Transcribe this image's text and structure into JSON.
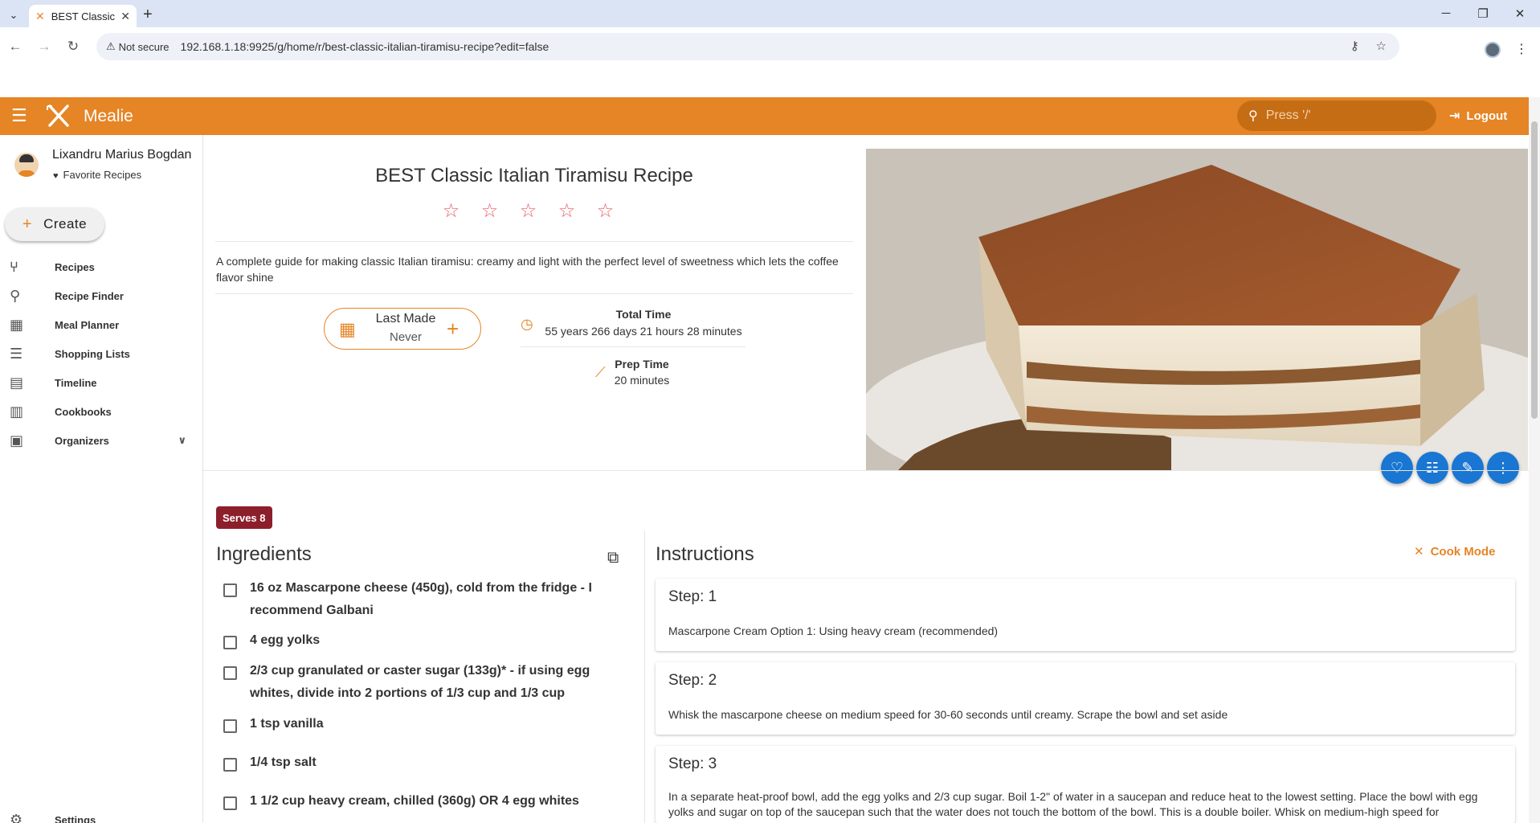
{
  "browser": {
    "tab_title": "BEST Classic",
    "not_secure": "Not secure",
    "url": "192.168.1.18:9925/g/home/r/best-classic-italian-tiramisu-recipe?edit=false"
  },
  "app": {
    "brand": "Mealie",
    "search_placeholder": "Press '/'",
    "logout": "Logout",
    "accent_color": "#e58525"
  },
  "sidebar": {
    "user_name": "Lixandru Marius Bogdan",
    "favorite": "Favorite Recipes",
    "create": "Create",
    "items": [
      {
        "label": "Recipes",
        "icon": "fork-knife-icon"
      },
      {
        "label": "Recipe Finder",
        "icon": "search-icon"
      },
      {
        "label": "Meal Planner",
        "icon": "calendar-icon"
      },
      {
        "label": "Shopping Lists",
        "icon": "checklist-icon"
      },
      {
        "label": "Timeline",
        "icon": "timeline-icon"
      },
      {
        "label": "Cookbooks",
        "icon": "book-icon"
      },
      {
        "label": "Organizers",
        "icon": "cabinet-icon"
      }
    ],
    "settings": "Settings"
  },
  "recipe": {
    "title": "BEST Classic Italian Tiramisu Recipe",
    "description": "A complete guide for making classic Italian tiramisu: creamy and light with the perfect level of sweetness which lets the coffee flavor shine",
    "last_made_label": "Last Made",
    "last_made_value": "Never",
    "total_time_label": "Total Time",
    "total_time_value": "55 years 266 days 21 hours 28 minutes",
    "prep_time_label": "Prep Time",
    "prep_time_value": "20 minutes",
    "serves": "Serves 8",
    "ingredients_title": "Ingredients",
    "instructions_title": "Instructions",
    "cook_mode": "Cook Mode",
    "ingredients": [
      "16 oz Mascarpone cheese (450g), cold from the fridge - I recommend Galbani",
      "4 egg yolks",
      "2/3 cup granulated or caster sugar (133g)* - if using egg whites, divide into 2 portions of 1/3 cup and 1/3 cup",
      "1 tsp vanilla",
      "1/4 tsp salt",
      "1 1/2 cup heavy cream, chilled (360g) OR 4 egg whites"
    ],
    "steps": [
      {
        "title": "Step: 1",
        "body": "Mascarpone Cream Option 1: Using heavy cream (recommended)"
      },
      {
        "title": "Step: 2",
        "body": "Whisk the mascarpone cheese on medium speed for 30-60 seconds until creamy. Scrape the bowl and set aside"
      },
      {
        "title": "Step: 3",
        "body": "In a separate heat-proof bowl, add the egg yolks and 2/3 cup sugar. Boil 1-2\" of water in a saucepan and reduce heat to the lowest setting. Place the bowl with egg yolks and sugar on top of the saucepan such that the water does not touch the bottom of the bowl. This is a double boiler. Whisk on medium-high speed for"
      }
    ]
  }
}
